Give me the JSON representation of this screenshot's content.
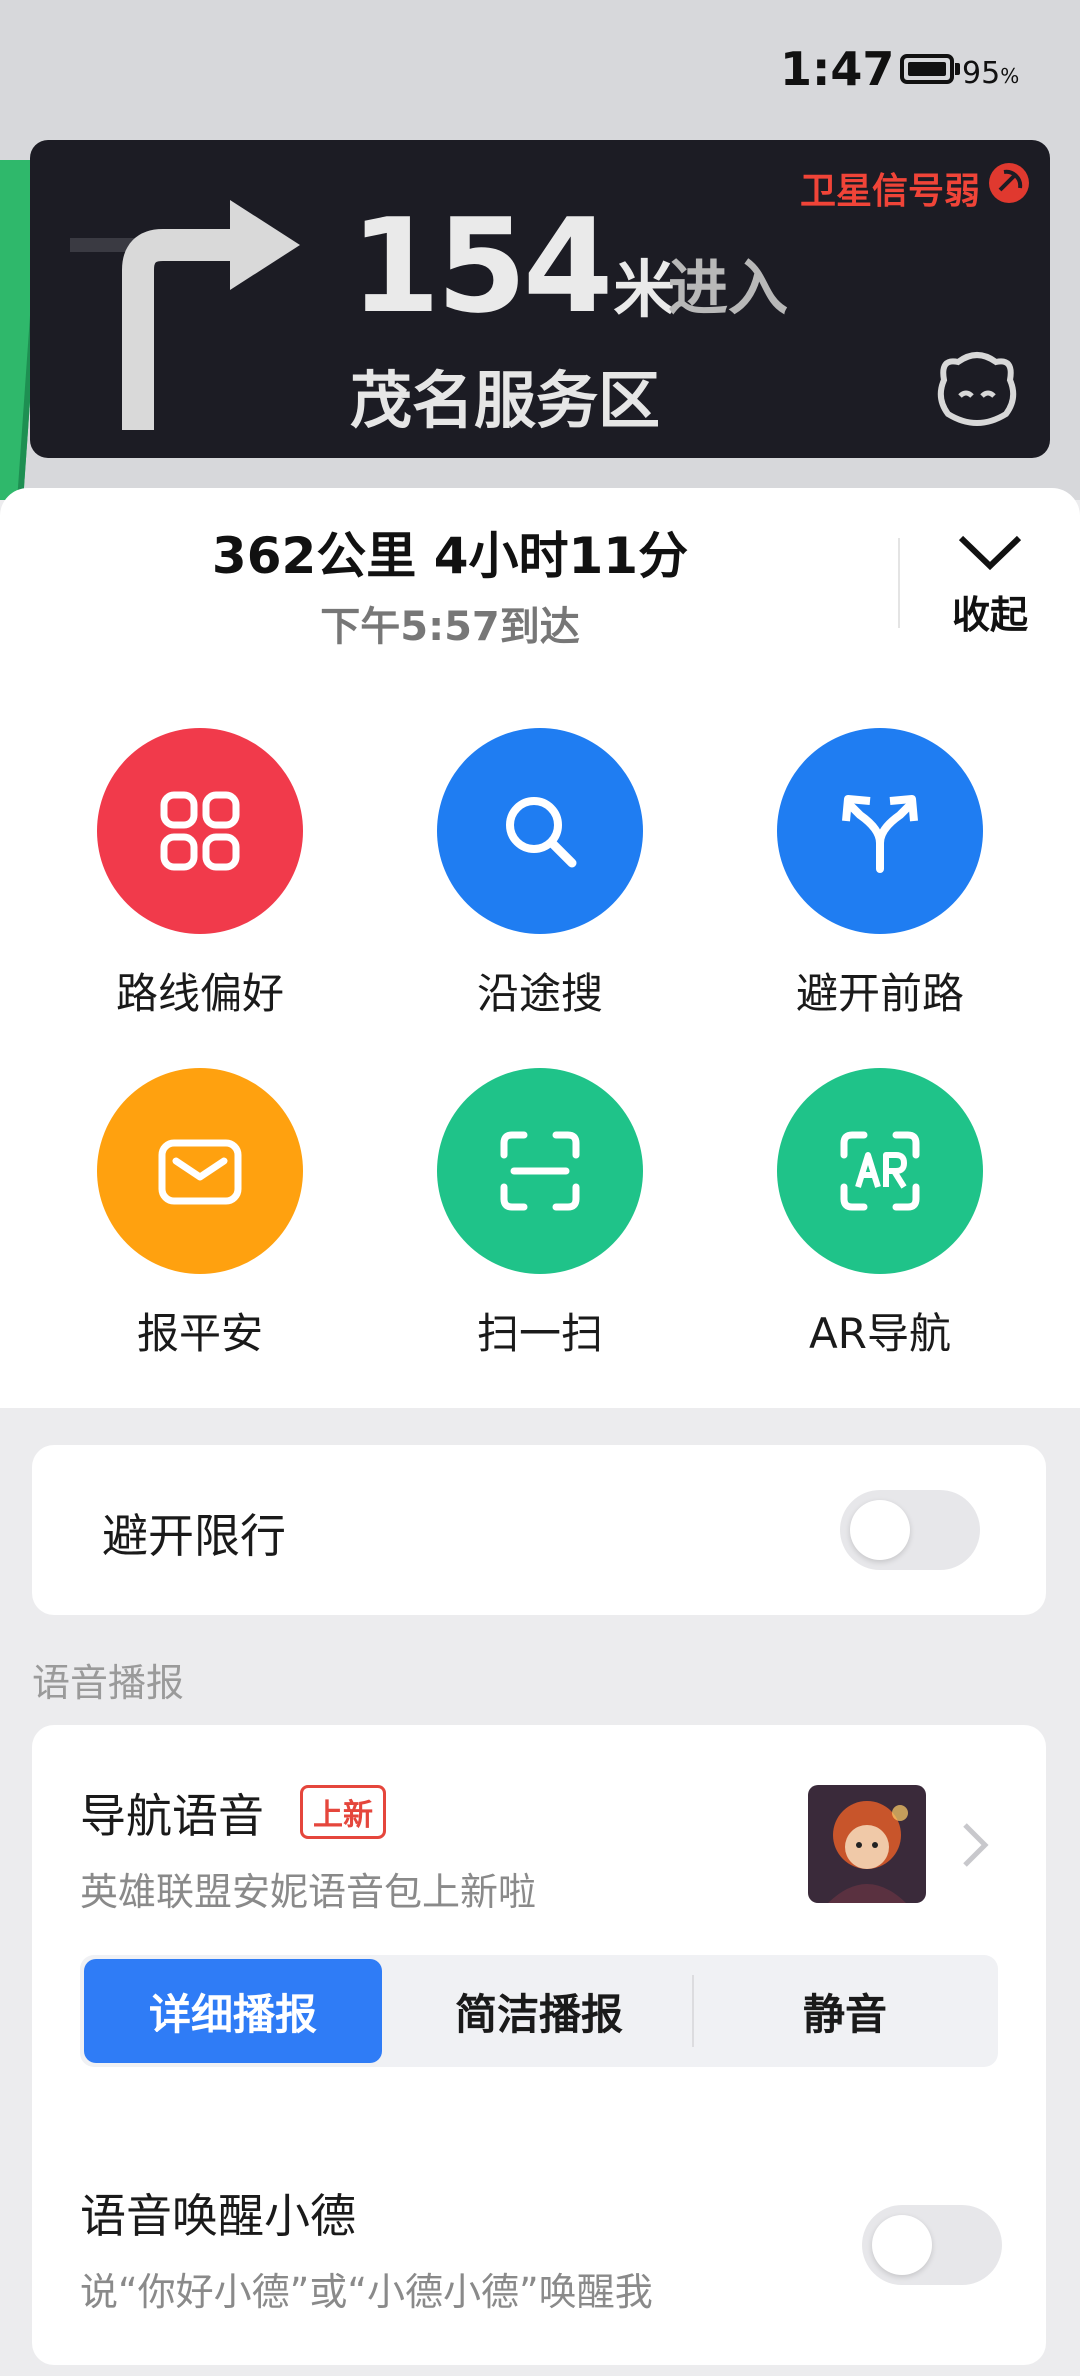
{
  "status_bar": {
    "time": "1:47",
    "battery_percent": "95",
    "battery_symbol": "%"
  },
  "nav": {
    "distance": "154",
    "unit": "米",
    "action": "进入",
    "road": "茂名服务区",
    "gps_status": "卫星信号弱"
  },
  "trip": {
    "summary": "362公里 4小时11分",
    "arrival": "下午5:57到达",
    "collapse_label": "收起"
  },
  "tools": [
    {
      "label": "路线偏好",
      "color": "#f13a4b",
      "icon": "grid-icon"
    },
    {
      "label": "沿途搜",
      "color": "#1f7df2",
      "icon": "search-icon"
    },
    {
      "label": "避开前路",
      "color": "#1f7df2",
      "icon": "fork-arrows-icon"
    },
    {
      "label": "报平安",
      "color": "#ffa10f",
      "icon": "mail-icon"
    },
    {
      "label": "扫一扫",
      "color": "#1fc389",
      "icon": "scan-icon"
    },
    {
      "label": "AR导航",
      "color": "#1fc389",
      "icon": "ar-icon"
    }
  ],
  "avoid_restriction": {
    "label": "避开限行",
    "enabled": false
  },
  "voice_section": {
    "title": "语音播报",
    "nav_voice_label": "导航语音",
    "new_badge": "上新",
    "nav_voice_desc": "英雄联盟安妮语音包上新啦",
    "modes": [
      "详细播报",
      "简洁播报",
      "静音"
    ],
    "active_mode": "详细播报"
  },
  "wake_word": {
    "label": "语音唤醒小德",
    "desc": "说“你好小德”或“小德小德”唤醒我",
    "enabled": false
  }
}
